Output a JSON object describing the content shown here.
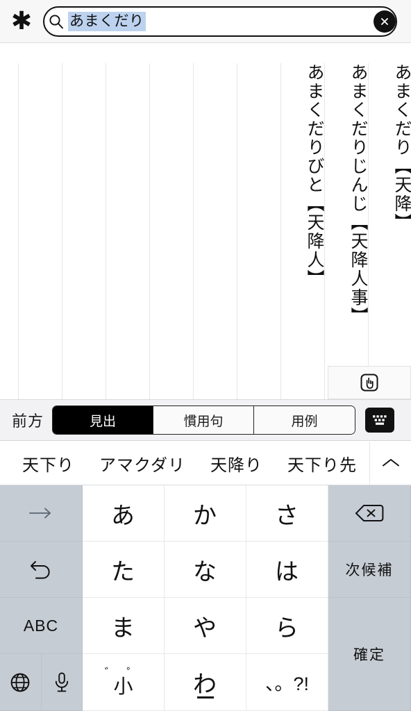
{
  "header": {
    "star_icon": "asterisk-icon",
    "search": {
      "icon": "search-icon",
      "value": "あまくだり",
      "placeholder": "",
      "clear_icon": "clear-circle-icon"
    }
  },
  "results": {
    "entries": [
      {
        "text": "あまくだりびと【天降人】"
      },
      {
        "text": "あまくだりじんじ【天降人事】"
      },
      {
        "text": "あまくだり【天降】"
      }
    ],
    "hand_icon": "pointing-hand-icon",
    "rule_count": 9,
    "rule_color": "#e6e6e6"
  },
  "toolbar": {
    "mode_label": "前方",
    "segments": [
      {
        "label": "見出",
        "active": true
      },
      {
        "label": "慣用句",
        "active": false
      },
      {
        "label": "用例",
        "active": false
      }
    ],
    "keyboard_icon": "keyboard-icon",
    "accent": "#000000"
  },
  "prediction": {
    "candidates": [
      "天下り",
      "アマクダリ",
      "天降り",
      "天下り先"
    ],
    "expand_icon": "chevron-up-icon"
  },
  "keyboard": {
    "rows": [
      [
        {
          "name": "key-cursor-right",
          "label": "→",
          "kind": "icon-arrow",
          "white": false
        },
        {
          "name": "key-a",
          "label": "あ",
          "kind": "kana",
          "white": true
        },
        {
          "name": "key-ka",
          "label": "か",
          "kind": "kana",
          "white": true
        },
        {
          "name": "key-sa",
          "label": "さ",
          "kind": "kana",
          "white": true
        },
        {
          "name": "key-delete",
          "label": "⌫",
          "kind": "icon-delete",
          "white": false
        }
      ],
      [
        {
          "name": "key-undo",
          "label": "↺",
          "kind": "icon-undo",
          "white": false
        },
        {
          "name": "key-ta",
          "label": "た",
          "kind": "kana",
          "white": true
        },
        {
          "name": "key-na",
          "label": "な",
          "kind": "kana",
          "white": true
        },
        {
          "name": "key-ha",
          "label": "は",
          "kind": "kana",
          "white": true
        },
        {
          "name": "key-next-candidate",
          "label": "次候補",
          "kind": "text",
          "white": false
        }
      ],
      [
        {
          "name": "key-abc",
          "label": "ABC",
          "kind": "abc",
          "white": false
        },
        {
          "name": "key-ma",
          "label": "ま",
          "kind": "kana",
          "white": true
        },
        {
          "name": "key-ya",
          "label": "や",
          "kind": "kana",
          "white": true
        },
        {
          "name": "key-ra",
          "label": "ら",
          "kind": "kana",
          "white": true
        },
        {
          "name": "key-confirm",
          "label": "確定",
          "kind": "text-tall",
          "white": false
        }
      ],
      [
        {
          "name": "key-globe",
          "label": "globe-icon",
          "kind": "split-globe-mic",
          "white": false
        },
        {
          "name": "key-dakuten-small",
          "label": "小",
          "label_top": "゛ ゜",
          "kind": "dakuten",
          "white": true
        },
        {
          "name": "key-wa",
          "label": "わ",
          "kind": "kana-underscore",
          "white": true
        },
        {
          "name": "key-punctuation",
          "label": "、。?!",
          "kind": "punct",
          "white": true
        }
      ]
    ],
    "mic_icon": "microphone-icon",
    "globe_icon": "globe-icon",
    "bg_color": "#c6ccd4"
  }
}
